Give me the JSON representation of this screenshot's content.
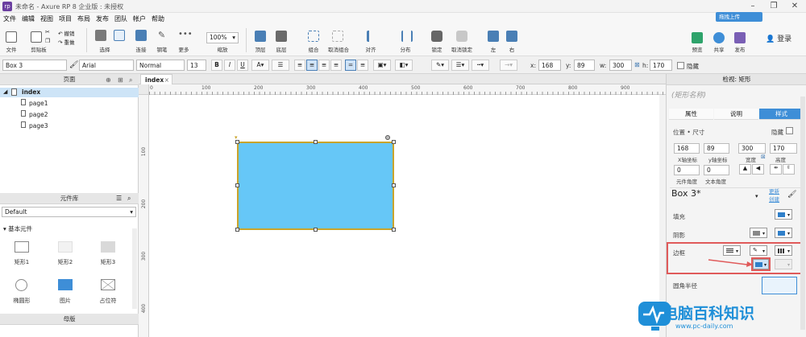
{
  "window": {
    "title": "未命名 - Axure RP 8 企业版 : 未授权",
    "logo": "rp"
  },
  "menu": [
    "文件",
    "编辑",
    "视图",
    "项目",
    "布局",
    "发布",
    "团队",
    "帐户",
    "帮助"
  ],
  "toolbar": {
    "file": "文件",
    "clipboard": "剪贴板",
    "undo": "撤销",
    "redo": "重做",
    "select": "选择",
    "connect": "连接",
    "pen": "钢笔",
    "more": "更多",
    "zoom_value": "100%",
    "zoom_label": "缩放",
    "top": "顶层",
    "bottom": "底层",
    "group": "组合",
    "ungroup": "取消组合",
    "align": "对齐",
    "distribute": "分布",
    "lock": "锁定",
    "unlock": "取消锁定",
    "left": "左",
    "right": "右",
    "preview": "预览",
    "share": "共享",
    "publish": "发布",
    "login": "登录",
    "upload": "拖拽上传"
  },
  "formatbar": {
    "widget_name": "Box 3",
    "font": "Arial",
    "style": "Normal",
    "size": "13",
    "x_label": "x:",
    "x": "168",
    "y_label": "y:",
    "y": "89",
    "w_label": "w:",
    "w": "300",
    "h_label": "h:",
    "h": "170",
    "hide": "隐藏"
  },
  "pages": {
    "header": "页面",
    "items": [
      "index",
      "page1",
      "page2",
      "page3"
    ]
  },
  "library": {
    "header": "元件库",
    "selected": "Default",
    "group": "基本元件",
    "widgets": [
      "矩形1",
      "矩形2",
      "矩形3",
      "椭圆形",
      "图片",
      "占位符"
    ]
  },
  "masters": {
    "header": "母版"
  },
  "canvas": {
    "tab": "index",
    "ruler_h": [
      "0",
      "100",
      "200",
      "300",
      "400",
      "500",
      "600",
      "700",
      "800",
      "900"
    ],
    "ruler_v": [
      "100",
      "200",
      "300",
      "400"
    ],
    "box_fill": "#66c7f7",
    "box_border": "#c9a42b"
  },
  "inspector": {
    "header": "检视: 矩形",
    "name_placeholder": "(矩形名称)",
    "tabs": [
      "属性",
      "说明",
      "样式"
    ],
    "position_size": "位置 • 尺寸",
    "hidden": "隐藏",
    "x": "168",
    "y": "89",
    "w": "300",
    "h": "170",
    "x_label": "X轴坐标",
    "y_label": "y轴坐标",
    "w_label": "宽度",
    "h_label": "高度",
    "rotate": "0",
    "text_rotate": "0",
    "rotate_label": "元件角度",
    "text_rotate_label": "文本角度",
    "style_name": "Box 3*",
    "update": "更新",
    "create": "创建",
    "fill": "填充",
    "shadow": "阴影",
    "border": "边框",
    "corner": "圆角半径",
    "fill_color": "#2f7fc9"
  },
  "watermark": {
    "text": "电脑百科知识",
    "url": "www.pc-daily.com"
  }
}
